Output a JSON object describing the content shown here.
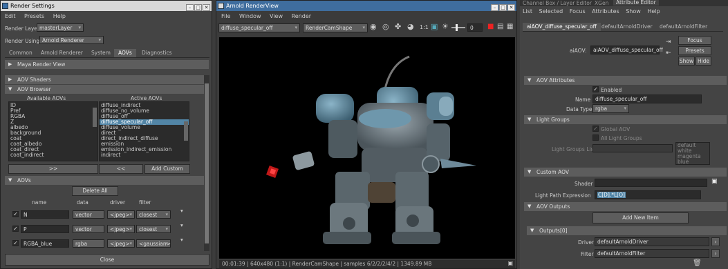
{
  "render_settings": {
    "title": "Render Settings",
    "menu": [
      "Edit",
      "Presets",
      "Help"
    ],
    "render_layer_label": "Render Layer",
    "render_layer_value": "masterLayer",
    "render_using_label": "Render Using",
    "render_using_value": "Arnold Renderer",
    "tabs": [
      "Common",
      "Arnold Renderer",
      "System",
      "AOVs",
      "Diagnostics"
    ],
    "maya_render_view": "Maya Render View",
    "aov_shaders": "AOV Shaders",
    "aov_browser": "AOV Browser",
    "available_header": "Available AOVs",
    "active_header": "Active AOVs",
    "available": [
      "ID",
      "Pref",
      "RGBA",
      "Z",
      "albedo",
      "background",
      "coat",
      "coat_albedo",
      "coat_direct",
      "coat_indirect"
    ],
    "active": [
      "diffuse_indirect",
      "diffuse_no_volume",
      "diffuse_off",
      "diffuse_specular_off",
      "diffuse_volume",
      "direct",
      "direct_indirect_diffuse",
      "emission",
      "emission_indirect_emission",
      "indirect"
    ],
    "move_right": ">>",
    "move_left": "<<",
    "add_custom": "Add Custom",
    "aovs_section": "AOVs",
    "delete_all": "Delete All",
    "cols": [
      "name",
      "data",
      "driver",
      "filter"
    ],
    "rows": [
      {
        "name": "N",
        "data": "vector",
        "driver": "<jpeg>",
        "filter": "closest"
      },
      {
        "name": "P",
        "data": "vector",
        "driver": "<jpeg>",
        "filter": "closest"
      },
      {
        "name": "RGBA_blue",
        "data": "rgba",
        "driver": "<jpeg>",
        "filter": "<gaussian>"
      }
    ],
    "close": "Close"
  },
  "render_view": {
    "title": "Arnold RenderView",
    "menu": [
      "File",
      "Window",
      "View",
      "Render"
    ],
    "aov_select": "diffuse_specular_off",
    "camera_select": "RenderCamShape",
    "ratio": "1:1",
    "exposure": "0",
    "status": "00:01:39 | 640x480 (1:1) | RenderCamShape | samples 6/2/2/2/4/2 | 1349.89 MB"
  },
  "attr_editor": {
    "top_tabs": [
      "Channel Box / Layer Editor",
      "XGen",
      "Attribute Editor"
    ],
    "menu": [
      "List",
      "Selected",
      "Focus",
      "Attributes",
      "Show",
      "Help"
    ],
    "node_tabs": [
      "aiAOV_diffuse_specular_off",
      "defaultArnoldDriver",
      "defaultArnoldFilter"
    ],
    "aiaov_label": "aiAOV:",
    "aiaov_value": "aiAOV_diffuse_specular_off",
    "focus": "Focus",
    "presets": "Presets",
    "show": "Show",
    "hide": "Hide",
    "aov_attributes": "AOV Attributes",
    "enabled": "Enabled",
    "name_label": "Name",
    "name_value": "diffuse_specular_off",
    "data_type_label": "Data Type",
    "data_type_value": "rgba",
    "light_groups": "Light Groups",
    "global_aov": "Global AOV",
    "all_light_groups": "All Light Groups",
    "light_groups_list_label": "Light Groups List",
    "light_groups_list": [
      "default",
      "white",
      "magenta",
      "blue"
    ],
    "custom_aov": "Custom AOV",
    "shader_label": "Shader",
    "lpe_label": "Light Path Expression",
    "lpe_value": "C[D].*L[O]",
    "aov_outputs": "AOV Outputs",
    "add_new_item": "Add New Item",
    "outputs": "Outputs[0]",
    "driver_label": "Driver",
    "driver_value": "defaultArnoldDriver",
    "filter_label": "Filter",
    "filter_value": "defaultArnoldFilter"
  }
}
